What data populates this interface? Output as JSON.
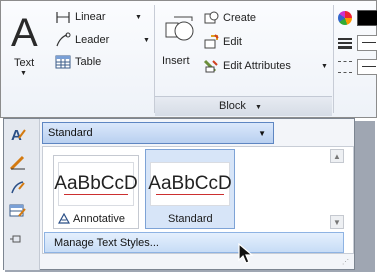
{
  "ribbon": {
    "text_button": {
      "label": "Text"
    },
    "linear": {
      "label": "Linear"
    },
    "leader": {
      "label": "Leader"
    },
    "table": {
      "label": "Table"
    },
    "block_panel": {
      "insert": {
        "label": "Insert"
      },
      "create": {
        "label": "Create"
      },
      "edit": {
        "label": "Edit"
      },
      "edit_attributes": {
        "label": "Edit Attributes"
      },
      "footer": {
        "label": "Block"
      }
    }
  },
  "style_dropdown": {
    "current_value": "Standard",
    "styles": [
      {
        "sample": "AaBbCcD",
        "name": "Annotative",
        "selected": false,
        "annotative": true
      },
      {
        "sample": "AaBbCcD",
        "name": "Standard",
        "selected": true,
        "annotative": false
      }
    ],
    "manage_label": "Manage Text Styles..."
  },
  "colors": {
    "accent_blue": "#b9d0f0",
    "selection_border": "#7ea3d6",
    "sample_underline": "#cc2f2f"
  },
  "icons": [
    "text-style-icon",
    "pencil-icon",
    "leader-style-icon",
    "table-style-icon",
    "pin-icon"
  ]
}
